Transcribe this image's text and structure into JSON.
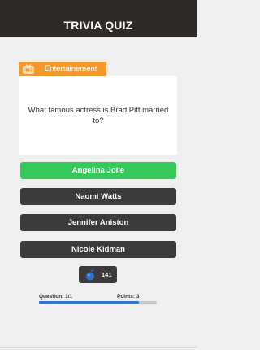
{
  "header": {
    "title": "TRIVIA QUIZ"
  },
  "category": {
    "label": "Entertainement",
    "icon": "tv-icon"
  },
  "question": {
    "text": "What famous actress is Brad Pitt married to?"
  },
  "answers": [
    {
      "label": "Angelina Jolie",
      "state": "correct"
    },
    {
      "label": "Naomi Watts",
      "state": "default"
    },
    {
      "label": "Jennifer Aniston",
      "state": "default"
    },
    {
      "label": "Nicole Kidman",
      "state": "default"
    }
  ],
  "coins": {
    "count": "141",
    "icon": "bomb-icon"
  },
  "stats": {
    "question_label": "Question: 1/1",
    "points_label": "Points: 3",
    "progress_fraction": 0.85
  },
  "colors": {
    "header": "#2e2a27",
    "category": "#f29b2b",
    "correct": "#34c759",
    "answer": "#3c3a3a",
    "progress": "#2f74d0"
  }
}
